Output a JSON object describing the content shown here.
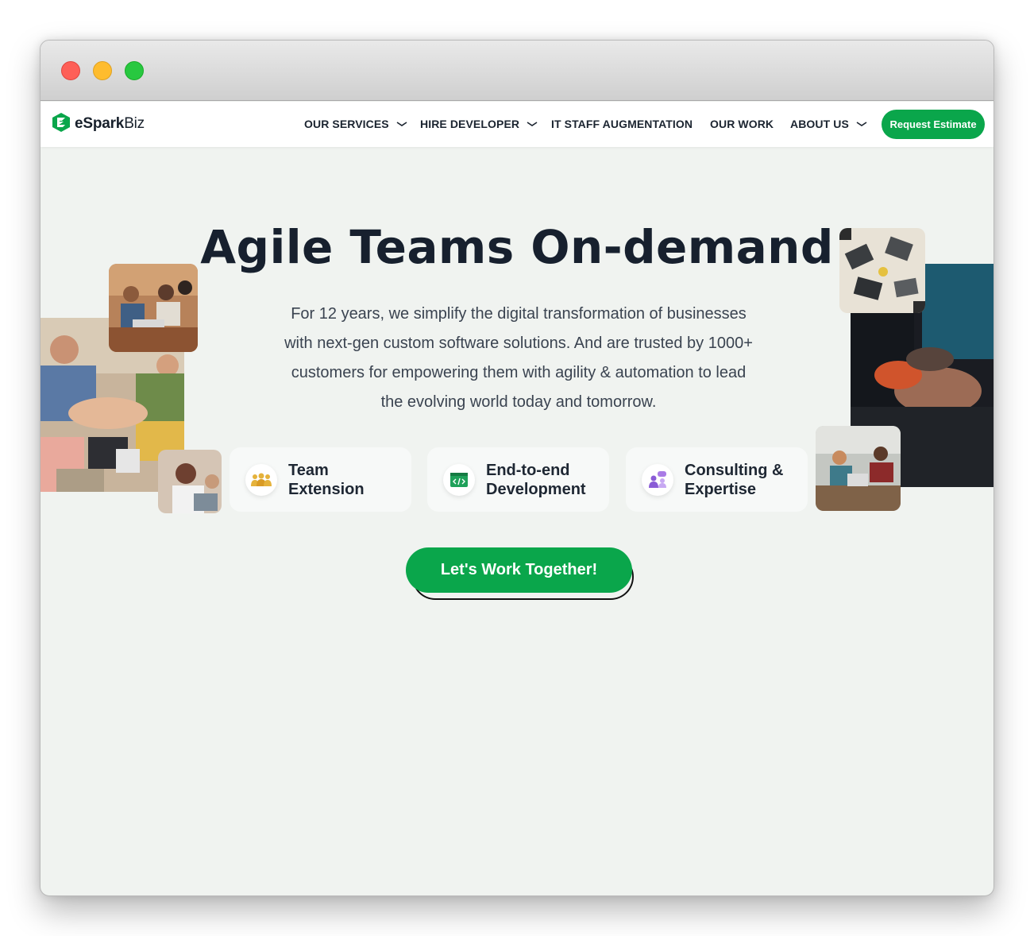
{
  "nav": {
    "logo": {
      "brand_bold": "eSpark",
      "brand_light": "Biz"
    },
    "items": [
      {
        "label": "OUR SERVICES",
        "dropdown": true
      },
      {
        "label": "HIRE DEVELOPER",
        "dropdown": true
      },
      {
        "label": "IT STAFF AUGMENTATION",
        "dropdown": false
      },
      {
        "label": "OUR WORK",
        "dropdown": false
      },
      {
        "label": "ABOUT US",
        "dropdown": true
      }
    ],
    "cta": "Request Estimate"
  },
  "hero": {
    "title": "Agile Teams On-demand",
    "subtitle": "For 12 years, we simplify the digital transformation of businesses with next-gen custom software solutions. And are trusted by 1000+ customers for empowering them with agility & automation to lead the evolving world today and tomorrow.",
    "cards": [
      {
        "line1": "Team",
        "line2": "Extension",
        "icon": "team-icon"
      },
      {
        "line1": "End-to-end",
        "line2": "Development",
        "icon": "code-window-icon"
      },
      {
        "line1": "Consulting &",
        "line2": "Expertise",
        "icon": "consulting-chat-icon"
      }
    ],
    "cta": "Let's Work Together!"
  },
  "colors": {
    "brand_green": "#0aa64b",
    "page_bg": "#f0f3f0",
    "text_dark": "#17202e"
  }
}
